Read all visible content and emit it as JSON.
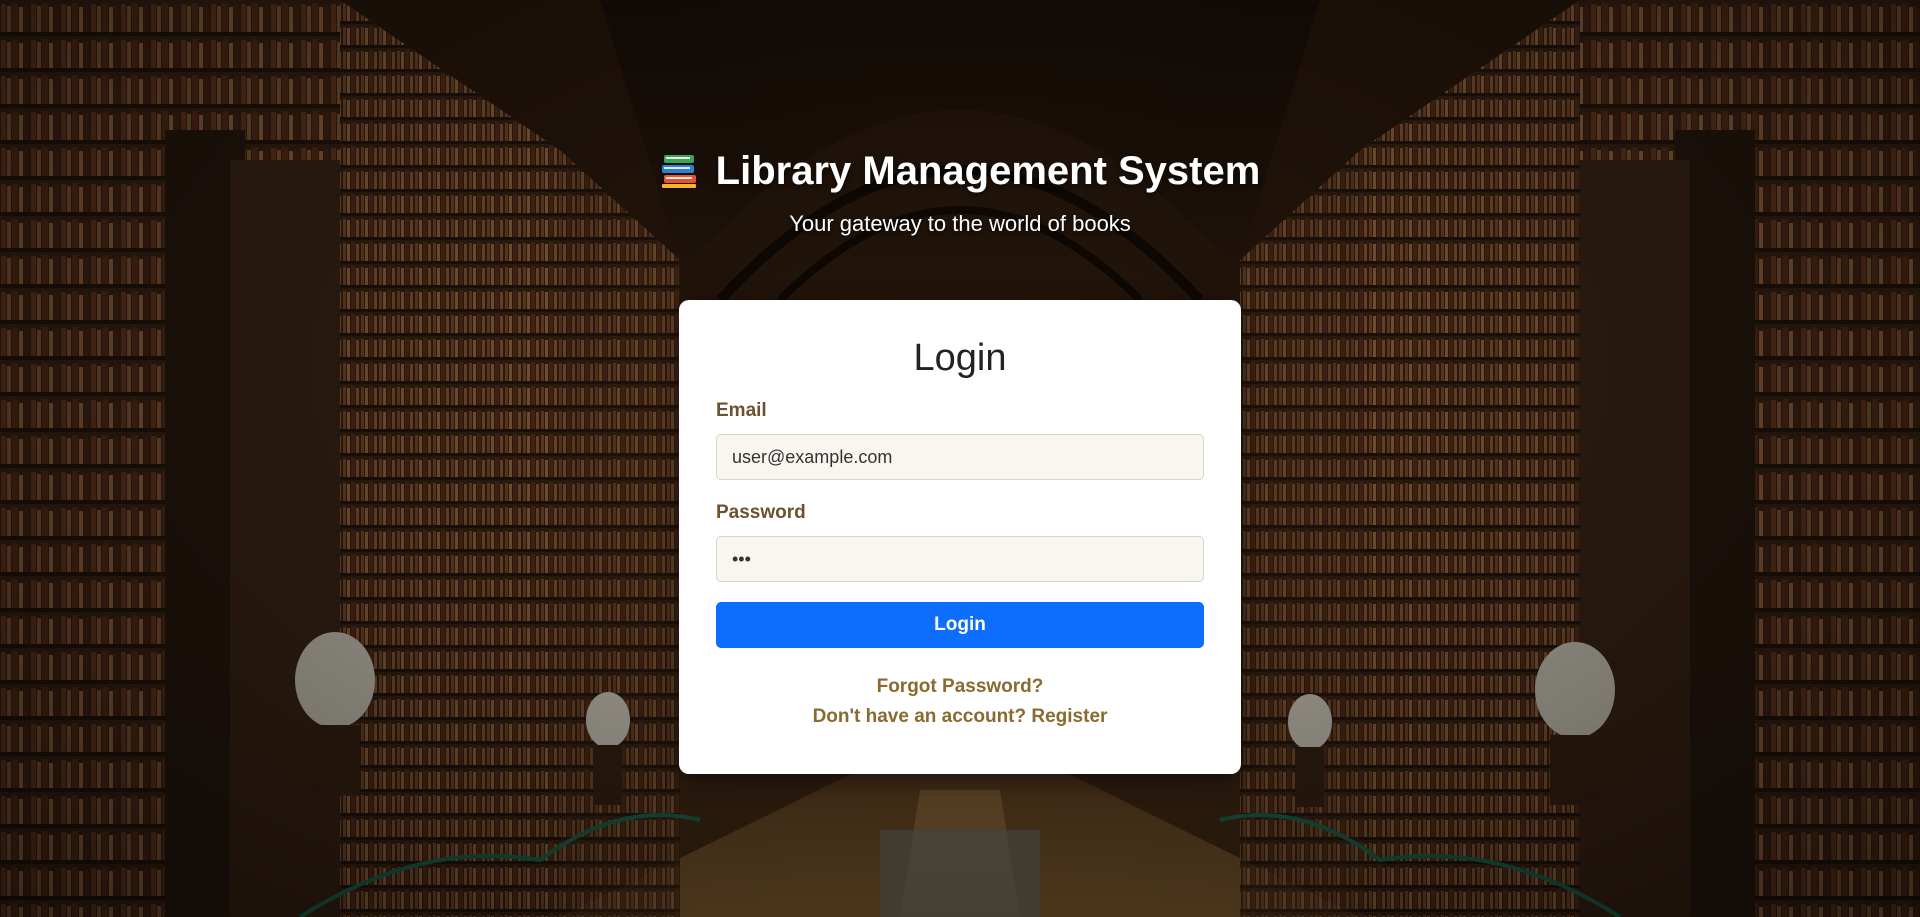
{
  "header": {
    "title": "Library Management System",
    "subtitle": "Your gateway to the world of books",
    "logo_icon": "books-icon"
  },
  "login_card": {
    "title": "Login",
    "email": {
      "label": "Email",
      "value": "user@example.com",
      "placeholder": "user@example.com"
    },
    "password": {
      "label": "Password",
      "value": "•••"
    },
    "submit_label": "Login",
    "forgot_password_link": "Forgot Password?",
    "register_link": "Don't have an account? Register"
  },
  "colors": {
    "primary_button": "#0d6efd",
    "link": "#8a6a2f",
    "label": "#6b5230",
    "input_bg": "#f9f6f0"
  }
}
